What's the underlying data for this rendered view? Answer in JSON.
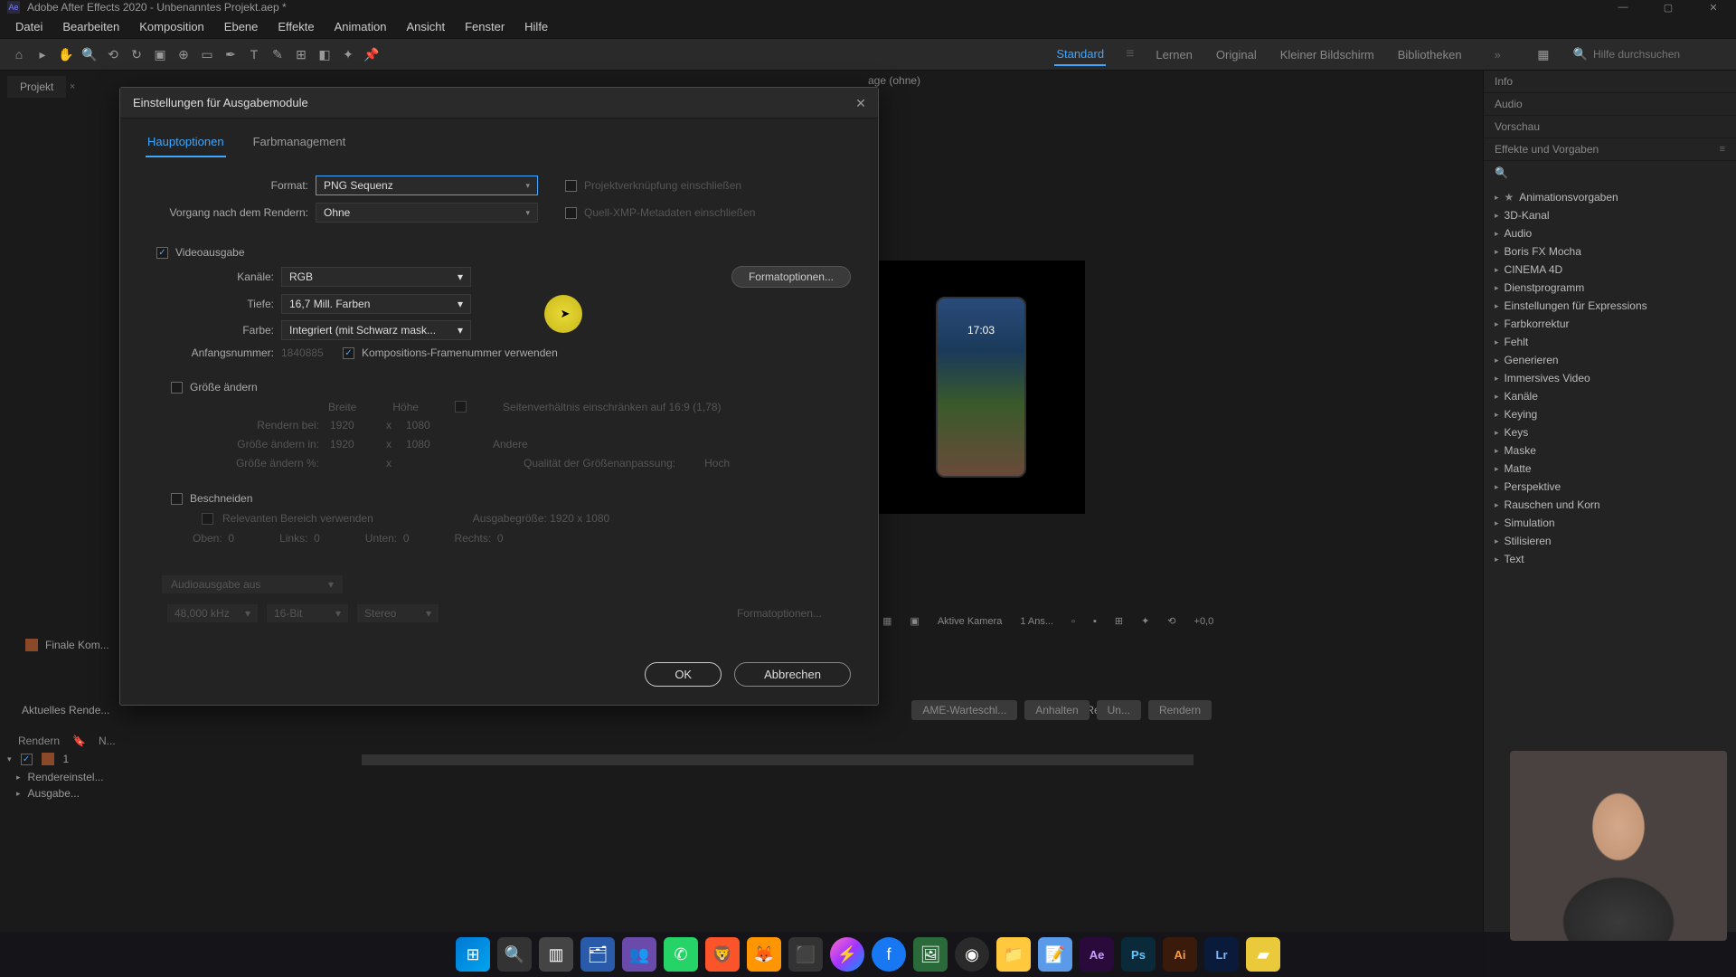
{
  "window": {
    "title": "Adobe After Effects 2020 - Unbenanntes Projekt.aep *"
  },
  "menubar": [
    "Datei",
    "Bearbeiten",
    "Komposition",
    "Ebene",
    "Effekte",
    "Animation",
    "Ansicht",
    "Fenster",
    "Hilfe"
  ],
  "workspaces": {
    "items": [
      "Standard",
      "Lernen",
      "Original",
      "Kleiner Bildschirm",
      "Bibliotheken"
    ],
    "active": "Standard",
    "search_placeholder": "Hilfe durchsuchen"
  },
  "left_panel": {
    "project_tab": "Projekt",
    "comp_label": "age (ohne)"
  },
  "viewer": {
    "phone_time": "17:03",
    "controls": {
      "camera": "Aktive Kamera",
      "views": "1 Ans...",
      "exposure": "+0,0"
    }
  },
  "bottom": {
    "comp_item": "Finale Kom...",
    "queue_label": "Aktuelles Rende...",
    "headers": {
      "render": "Rendern",
      "num": "N..."
    },
    "row_num": "1",
    "row_render": "Rendereinstel...",
    "row_output": "Ausgabe...",
    "gesch": "Gesch. Restz.:",
    "btn_queue": "AME-Warteschl...",
    "btn_pause": "Anhalten",
    "btn_stop": "Un...",
    "btn_render": "Rendern"
  },
  "right_panel": {
    "sections": [
      "Info",
      "Audio",
      "Vorschau",
      "Effekte und Vorgaben"
    ],
    "tree": [
      "Animationsvorgaben",
      "3D-Kanal",
      "Audio",
      "Boris FX Mocha",
      "CINEMA 4D",
      "Dienstprogramm",
      "Einstellungen für Expressions",
      "Farbkorrektur",
      "Fehlt",
      "Generieren",
      "Immersives Video",
      "Kanäle",
      "Keying",
      "Keys",
      "Maske",
      "Matte",
      "Perspektive",
      "Rauschen und Korn",
      "Simulation",
      "Stilisieren",
      "Text"
    ]
  },
  "dialog": {
    "title": "Einstellungen für Ausgabemodule",
    "tabs": {
      "main": "Hauptoptionen",
      "color": "Farbmanagement"
    },
    "format_label": "Format:",
    "format_value": "PNG Sequenz",
    "postrender_label": "Vorgang nach dem Rendern:",
    "postrender_value": "Ohne",
    "link_proj": "Projektverknüpfung einschließen",
    "xmp": "Quell-XMP-Metadaten einschließen",
    "video_out": "Videoausgabe",
    "channels_label": "Kanäle:",
    "channels_value": "RGB",
    "depth_label": "Tiefe:",
    "depth_value": "16,7 Mill. Farben",
    "color_label": "Farbe:",
    "color_value": "Integriert (mit Schwarz mask...",
    "startnum_label": "Anfangsnummer:",
    "startnum_value": "1840885",
    "use_comp_frame": "Kompositions-Framenummer verwenden",
    "format_opts": "Formatoptionen...",
    "resize": {
      "label": "Größe ändern",
      "width": "Breite",
      "height": "Höhe",
      "lock_aspect": "Seitenverhältnis einschränken auf 16:9 (1,78)",
      "render_at": "Rendern bei:",
      "resize_to": "Größe ändern in:",
      "resize_pct": "Größe ändern %:",
      "w1": "1920",
      "h1": "1080",
      "w2": "1920",
      "h2": "1080",
      "custom": "Andere",
      "quality_label": "Qualität der Größenanpassung:",
      "quality_value": "Hoch"
    },
    "crop": {
      "label": "Beschneiden",
      "roi": "Relevanten Bereich verwenden",
      "size_label": "Ausgabegröße: 1920 x 1080",
      "top": "Oben:",
      "left": "Links:",
      "bottom": "Unten:",
      "right": "Rechts:",
      "zero": "0"
    },
    "audio": {
      "mode": "Audioausgabe aus",
      "rate": "48,000 kHz",
      "bits": "16-Bit",
      "channels": "Stereo",
      "fmt_opts": "Formatoptionen..."
    },
    "buttons": {
      "ok": "OK",
      "cancel": "Abbrechen"
    }
  }
}
